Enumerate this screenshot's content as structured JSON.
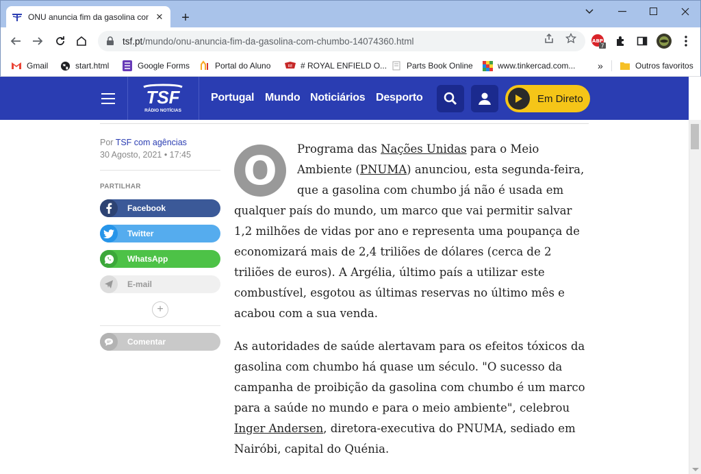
{
  "browser": {
    "tab_title": "ONU anuncia fim da gasolina com chumbo",
    "url_host": "tsf.pt",
    "url_path": "/mundo/onu-anuncia-fim-da-gasolina-com-chumbo-14074360.html",
    "extension_badge": "7",
    "extension_label": "ABP"
  },
  "bookmarks": [
    {
      "label": "Gmail",
      "icon": "gmail-icon"
    },
    {
      "label": "start.html",
      "icon": "globe-icon"
    },
    {
      "label": "Google Forms",
      "icon": "forms-icon"
    },
    {
      "label": "Portal do Aluno",
      "icon": "portal-icon"
    },
    {
      "label": "# ROYAL ENFIELD O...",
      "icon": "royal-enfield-icon"
    },
    {
      "label": "Parts Book Online",
      "icon": "parts-book-icon"
    },
    {
      "label": "www.tinkercad.com...",
      "icon": "tinkercad-icon"
    }
  ],
  "bookmarks_other": "Outros favoritos",
  "header": {
    "logo_text": "TSF",
    "logo_sub": "RÁDIO NOTÍCIAS",
    "nav": [
      "Portugal",
      "Mundo",
      "Noticiários",
      "Desporto"
    ],
    "live_label": "Em Direto",
    "colors": {
      "header_bg": "#2a3db2",
      "live_bg": "#f5c518"
    }
  },
  "sidebar": {
    "by_prefix": "Por",
    "author": "TSF com agências",
    "date": "30 Agosto, 2021 • 17:45",
    "share_title": "PARTILHAR",
    "share": [
      {
        "label": "Facebook",
        "color": "#3b5998"
      },
      {
        "label": "Twitter",
        "color": "#55acee"
      },
      {
        "label": "WhatsApp",
        "color": "#4dc247"
      },
      {
        "label": "E-mail",
        "color": "#f0f0f0"
      }
    ],
    "comment_label": "Comentar"
  },
  "article": {
    "dropcap": "O",
    "p1_a": "Programa das ",
    "p1_link1": "Nações Unidas",
    "p1_b": " para o Meio Ambiente (",
    "p1_link2": "PNUMA",
    "p1_c": ") anunciou, esta segunda-feira, que a gasolina com chumbo já não é usada em qualquer país do mundo, um marco que vai permitir salvar 1,2 milhões de vidas por ano e representa uma poupança de economizará mais de 2,4 triliões de dólares (cerca de 2 triliões de euros). A Argélia, último país a utilizar este combustível, esgotou as últimas reservas no último mês e acabou com a sua venda.",
    "p2_a": "As autoridades de saúde alertavam para os efeitos tóxicos da gasolina com chumbo há quase um século. \"O sucesso da campanha de proibição da gasolina com chumbo é um marco para a saúde no mundo e para o meio ambiente\", celebrou ",
    "p2_link": "Inger Andersen",
    "p2_b": ", diretora-executiva do PNUMA, sediado em Nairóbi, capital do Quénia."
  }
}
